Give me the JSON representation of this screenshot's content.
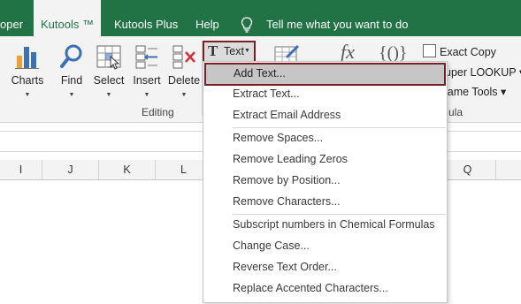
{
  "tabs": {
    "developer": "oper",
    "kutools": "Kutools ™",
    "kutools_plus": "Kutools Plus",
    "help": "Help",
    "tell_me": "Tell me what you want to do"
  },
  "ribbon": {
    "buttons": {
      "charts": "Charts",
      "find": "Find",
      "select": "Select",
      "insert": "Insert",
      "delete": "Delete",
      "text": "Text"
    },
    "groups": {
      "editing": "Editing",
      "formula": "ula"
    },
    "right_commands": {
      "exact_copy": "Exact Copy",
      "super_lookup": "uper LOOKUP ▾",
      "name_tools": "lame Tools ▾"
    },
    "symbols": {
      "fx": "fx",
      "braces": "{()}"
    }
  },
  "columns": {
    "visible": [
      "I",
      "J",
      "K",
      "L",
      "Q"
    ]
  },
  "text_menu": {
    "items": [
      "Add Text...",
      "Extract Text...",
      "Extract Email Address",
      "Remove Spaces...",
      "Remove Leading Zeros",
      "Remove by Position...",
      "Remove Characters...",
      "Subscript numbers in Chemical Formulas",
      "Change Case...",
      "Reverse Text Order...",
      "Replace Accented Characters..."
    ],
    "highlighted_index": 0
  },
  "colors": {
    "accent": "#217346",
    "highlight_border": "#7a1e2a",
    "highlight_fill": "#c6c6c6"
  }
}
